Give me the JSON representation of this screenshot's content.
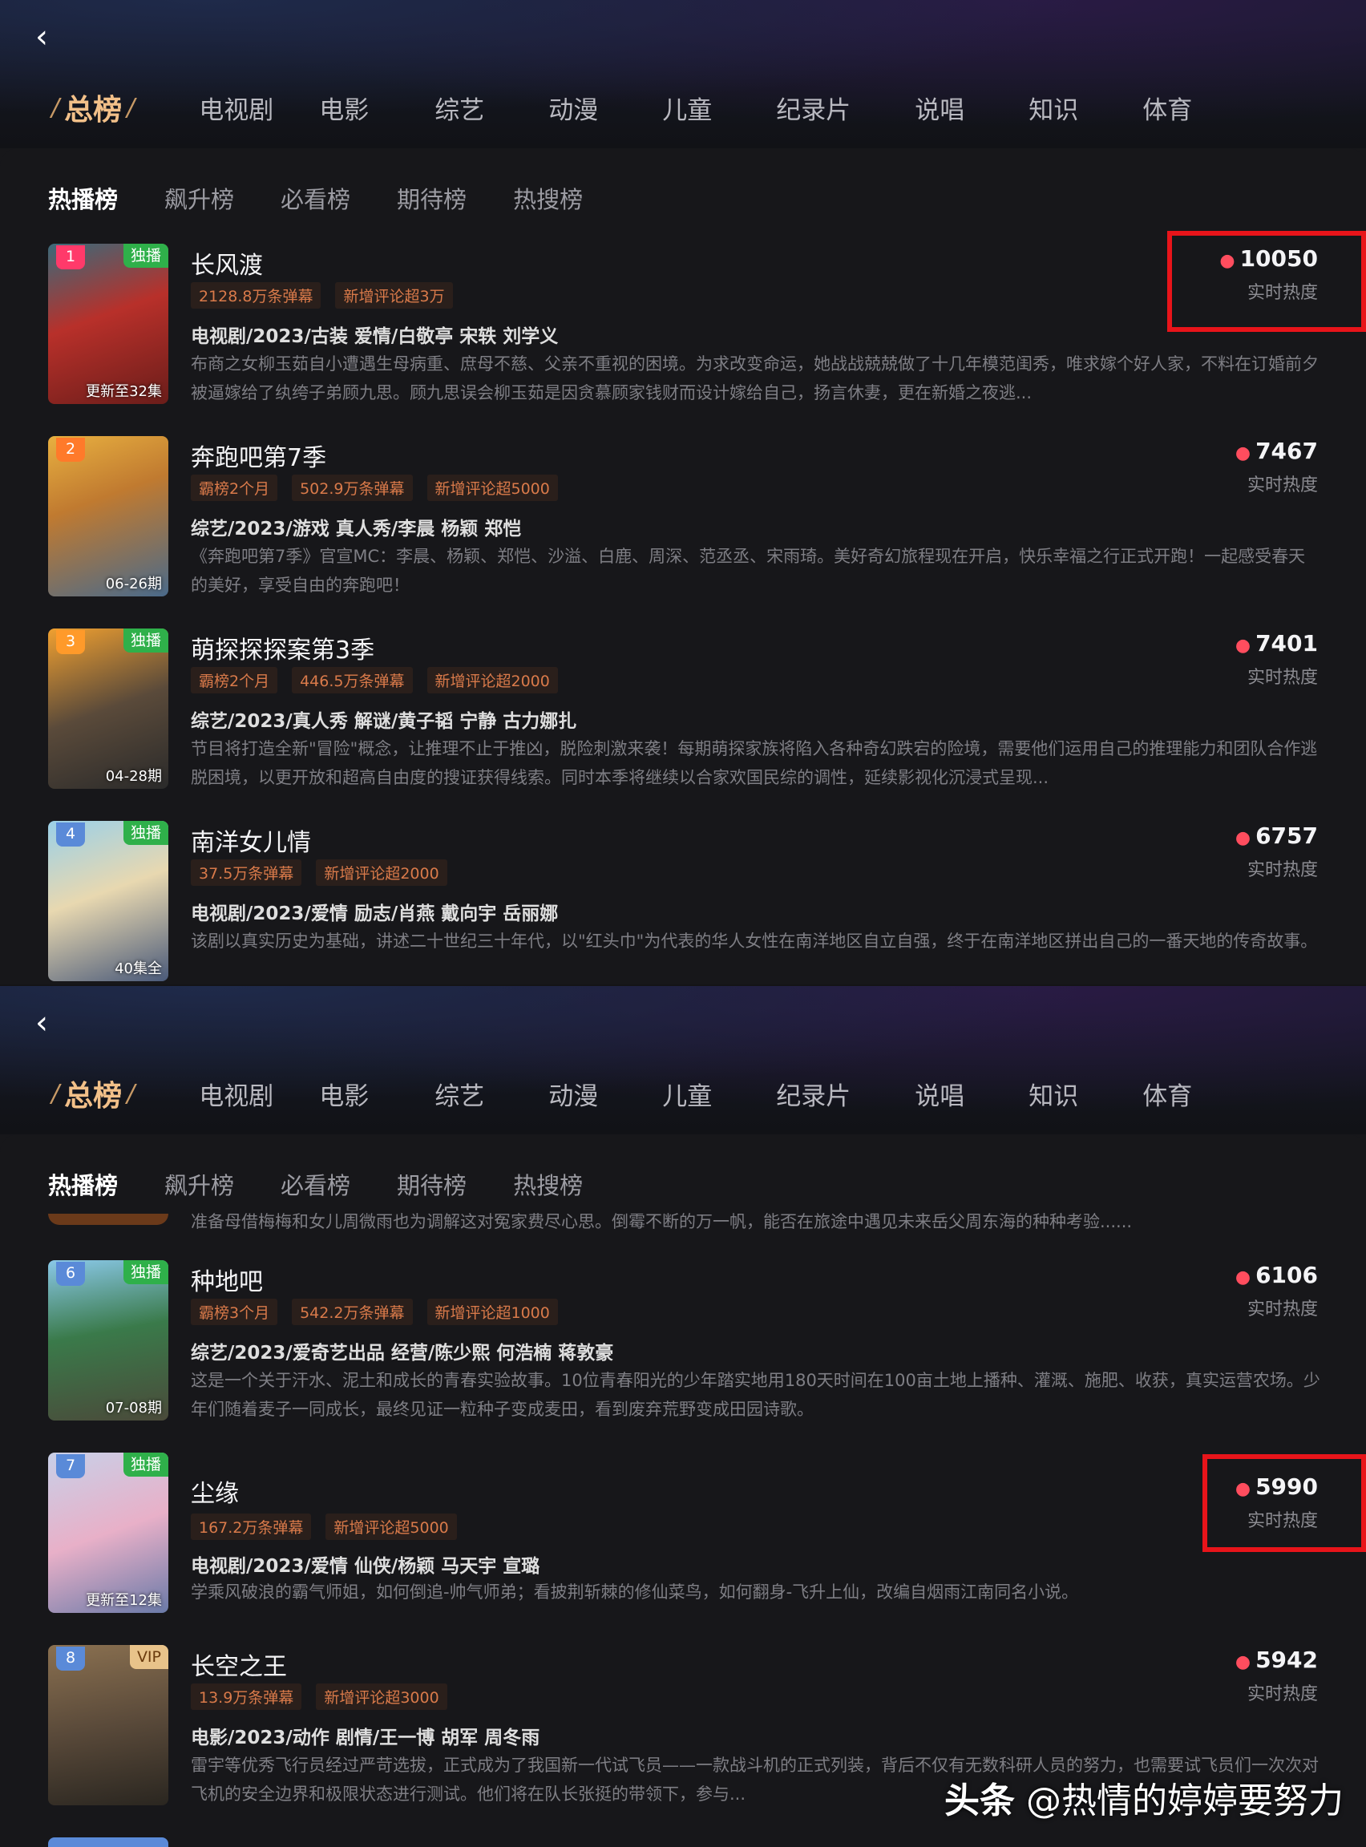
{
  "nav": {
    "back": "‹",
    "categories": [
      "总榜",
      "电视剧",
      "电影",
      "综艺",
      "动漫",
      "儿童",
      "纪录片",
      "说唱",
      "知识",
      "体育"
    ],
    "subtabs": [
      "热播榜",
      "飙升榜",
      "必看榜",
      "期待榜",
      "热搜榜"
    ]
  },
  "heat_label": "实时热度",
  "panel1": {
    "items": [
      {
        "rank": "1",
        "tag": "独播",
        "episode": "更新至32集",
        "title": "长风渡",
        "badges": [
          "2128.8万条弹幕",
          "新增评论超3万"
        ],
        "meta": "电视剧/2023/古装 爱情/白敬亭 宋轶 刘学义",
        "desc": "布商之女柳玉茹自小遭遇生母病重、庶母不慈、父亲不重视的困境。为求改变命运，她战战兢兢做了十几年模范闺秀，唯求嫁个好人家，不料在订婚前夕被逼嫁给了纨绔子弟顾九思。顾九思误会柳玉茹是因贪慕顾家钱财而设计嫁给自己，扬言休妻，更在新婚之夜逃...",
        "heat": "10050"
      },
      {
        "rank": "2",
        "tag": "",
        "episode": "06-26期",
        "title": "奔跑吧第7季",
        "badges": [
          "霸榜2个月",
          "502.9万条弹幕",
          "新增评论超5000"
        ],
        "meta": "综艺/2023/游戏 真人秀/李晨 杨颖 郑恺",
        "desc": "《奔跑吧第7季》官宣MC：李晨、杨颖、郑恺、沙溢、白鹿、周深、范丞丞、宋雨琦。美好奇幻旅程现在开启，快乐幸福之行正式开跑！一起感受春天的美好，享受自由的奔跑吧！",
        "heat": "7467"
      },
      {
        "rank": "3",
        "tag": "独播",
        "episode": "04-28期",
        "title": "萌探探探案第3季",
        "badges": [
          "霸榜2个月",
          "446.5万条弹幕",
          "新增评论超2000"
        ],
        "meta": "综艺/2023/真人秀 解谜/黄子韬 宁静 古力娜扎",
        "desc": "节目将打造全新\"冒险\"概念，让推理不止于推凶，脱险刺激来袭！每期萌探家族将陷入各种奇幻跌宕的险境，需要他们运用自己的推理能力和团队合作逃脱困境，以更开放和超高自由度的搜证获得线索。同时本季将继续以合家欢国民综的调性，延续影视化沉浸式呈现...",
        "heat": "7401"
      },
      {
        "rank": "4",
        "tag": "独播",
        "episode": "40集全",
        "title": "南洋女儿情",
        "badges": [
          "37.5万条弹幕",
          "新增评论超2000"
        ],
        "meta": "电视剧/2023/爱情 励志/肖燕 戴向宇 岳丽娜",
        "desc": "该剧以真实历史为基础，讲述二十世纪三十年代，以\"红头巾\"为代表的华人女性在南洋地区自立自强，终于在南洋地区拼出自己的一番天地的传奇故事。",
        "heat": "6757"
      }
    ]
  },
  "panel2": {
    "partial_desc": "准备母借梅梅和女儿周微雨也为调解这对冤家费尽心思。倒霉不断的万一帆，能否在旅途中遇见未来岳父周东海的种种考验......",
    "items": [
      {
        "rank": "6",
        "tag": "独播",
        "episode": "07-08期",
        "title": "种地吧",
        "badges": [
          "霸榜3个月",
          "542.2万条弹幕",
          "新增评论超1000"
        ],
        "meta": "综艺/2023/爱奇艺出品 经营/陈少熙 何浩楠 蒋敦豪",
        "desc": "这是一个关于汗水、泥土和成长的青春实验故事。10位青春阳光的少年踏实地用180天时间在100亩土地上播种、灌溉、施肥、收获，真实运营农场。少年们随着麦子一同成长，最终见证一粒种子变成麦田，看到废弃荒野变成田园诗歌。",
        "heat": "6106"
      },
      {
        "rank": "7",
        "tag": "独播",
        "episode": "更新至12集",
        "title": "尘缘",
        "badges": [
          "167.2万条弹幕",
          "新增评论超5000"
        ],
        "meta": "电视剧/2023/爱情 仙侠/杨颖 马天宇 宣璐",
        "desc": "学乘风破浪的霸气师姐，如何倒追-帅气师弟；看披荆斩棘的修仙菜鸟，如何翻身-飞升上仙，改编自烟雨江南同名小说。",
        "heat": "5990"
      },
      {
        "rank": "8",
        "tag": "VIP",
        "episode": "",
        "title": "长空之王",
        "badges": [
          "13.9万条弹幕",
          "新增评论超3000"
        ],
        "meta": "电影/2023/动作 剧情/王一博 胡军 周冬雨",
        "desc": "雷宇等优秀飞行员经过严苛选拔，正式成为了我国新一代试飞员——一款战斗机的正式列装，背后不仅有无数科研人员的努力，也需要试飞员们一次次对飞机的安全边界和极限状态进行测试。他们将在队长张挺的带领下，参与...",
        "heat": "5942"
      }
    ]
  },
  "watermark": {
    "brand": "头条",
    "handle": "@热情的婷婷要努力"
  },
  "colors": {
    "accent": "#f2c089",
    "flame": "#ff4d5e",
    "badge_text": "#d97a4a",
    "highlight_box": "#e8141a",
    "exclusive_tag": "#2fb04a"
  }
}
